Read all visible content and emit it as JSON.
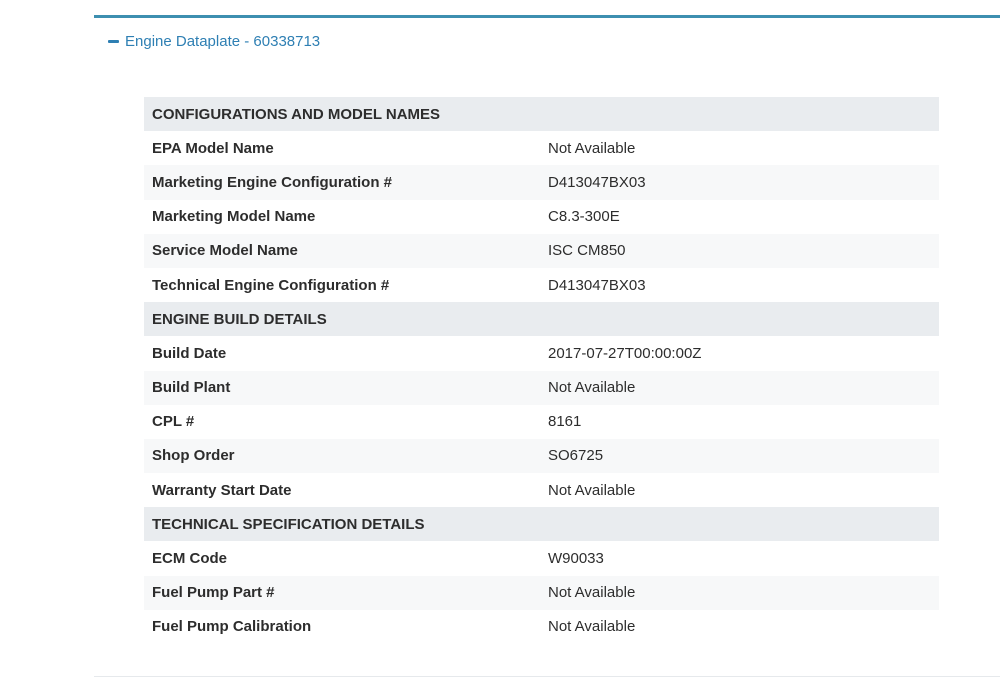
{
  "panel": {
    "title": "Engine Dataplate - 60338713",
    "toggle_icon": "minus-icon"
  },
  "sections": [
    {
      "heading": "CONFIGURATIONS AND MODEL NAMES",
      "rows": [
        {
          "label": "EPA Model Name",
          "value": "Not Available"
        },
        {
          "label": "Marketing Engine Configuration #",
          "value": "D413047BX03"
        },
        {
          "label": "Marketing Model Name",
          "value": "C8.3-300E"
        },
        {
          "label": "Service Model Name",
          "value": "ISC CM850"
        },
        {
          "label": "Technical Engine Configuration #",
          "value": "D413047BX03"
        }
      ]
    },
    {
      "heading": "ENGINE BUILD DETAILS",
      "rows": [
        {
          "label": "Build Date",
          "value": "2017-07-27T00:00:00Z"
        },
        {
          "label": "Build Plant",
          "value": "Not Available"
        },
        {
          "label": "CPL #",
          "value": "8161"
        },
        {
          "label": "Shop Order",
          "value": "SO6725"
        },
        {
          "label": "Warranty Start Date",
          "value": "Not Available"
        }
      ]
    },
    {
      "heading": "TECHNICAL SPECIFICATION DETAILS",
      "rows": [
        {
          "label": "ECM Code",
          "value": "W90033"
        },
        {
          "label": "Fuel Pump Part #",
          "value": "Not Available"
        },
        {
          "label": "Fuel Pump Calibration",
          "value": "Not Available"
        }
      ]
    }
  ]
}
